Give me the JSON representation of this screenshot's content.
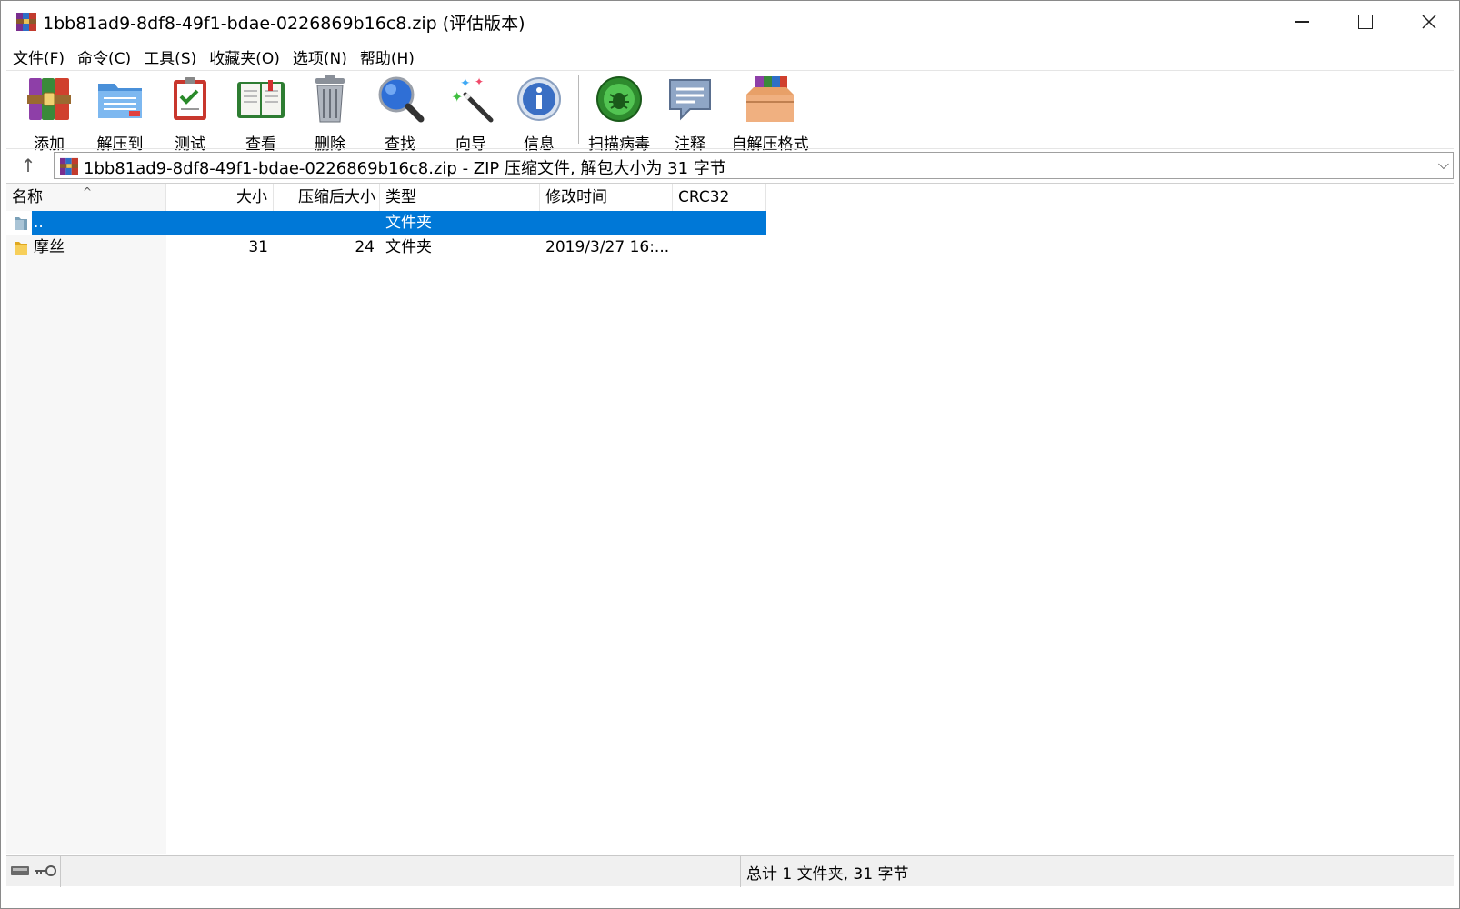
{
  "window": {
    "title": "1bb81ad9-8df8-49f1-bdae-0226869b16c8.zip (评估版本)",
    "minimize_label": "—",
    "maximize_label": "☐",
    "close_label": "✕"
  },
  "menu": [
    "文件(F)",
    "命令(C)",
    "工具(S)",
    "收藏夹(O)",
    "选项(N)",
    "帮助(H)"
  ],
  "toolbar": [
    {
      "label": "添加",
      "icon": "add-archive-icon"
    },
    {
      "label": "解压到",
      "icon": "extract-to-icon"
    },
    {
      "label": "测试",
      "icon": "test-icon"
    },
    {
      "label": "查看",
      "icon": "view-book-icon"
    },
    {
      "label": "删除",
      "icon": "trash-icon"
    },
    {
      "label": "查找",
      "icon": "magnifier-icon"
    },
    {
      "label": "向导",
      "icon": "magic-wand-icon"
    },
    {
      "label": "信息",
      "icon": "info-icon"
    },
    {
      "label": "扫描病毒",
      "icon": "virus-scan-icon"
    },
    {
      "label": "注释",
      "icon": "comment-icon"
    },
    {
      "label": "自解压格式",
      "icon": "sfx-box-icon"
    }
  ],
  "address": {
    "text": "1bb81ad9-8df8-49f1-bdae-0226869b16c8.zip - ZIP 压缩文件, 解包大小为 31 字节",
    "up_label": "↑",
    "dropdown_label": "⌵"
  },
  "columns": [
    "名称",
    "大小",
    "压缩后大小",
    "类型",
    "修改时间",
    "CRC32"
  ],
  "rows": [
    {
      "name": "..",
      "size": "",
      "packed": "",
      "type": "文件夹",
      "modified": "",
      "crc": "",
      "selected": true
    },
    {
      "name": "摩丝",
      "size": "31",
      "packed": "24",
      "type": "文件夹",
      "modified": "2019/3/27 16:...",
      "crc": "",
      "selected": false
    }
  ],
  "status": {
    "summary": "总计 1 文件夹, 31 字节"
  },
  "colors": {
    "selection": "#0078d7",
    "folder": "#f2c14e"
  }
}
